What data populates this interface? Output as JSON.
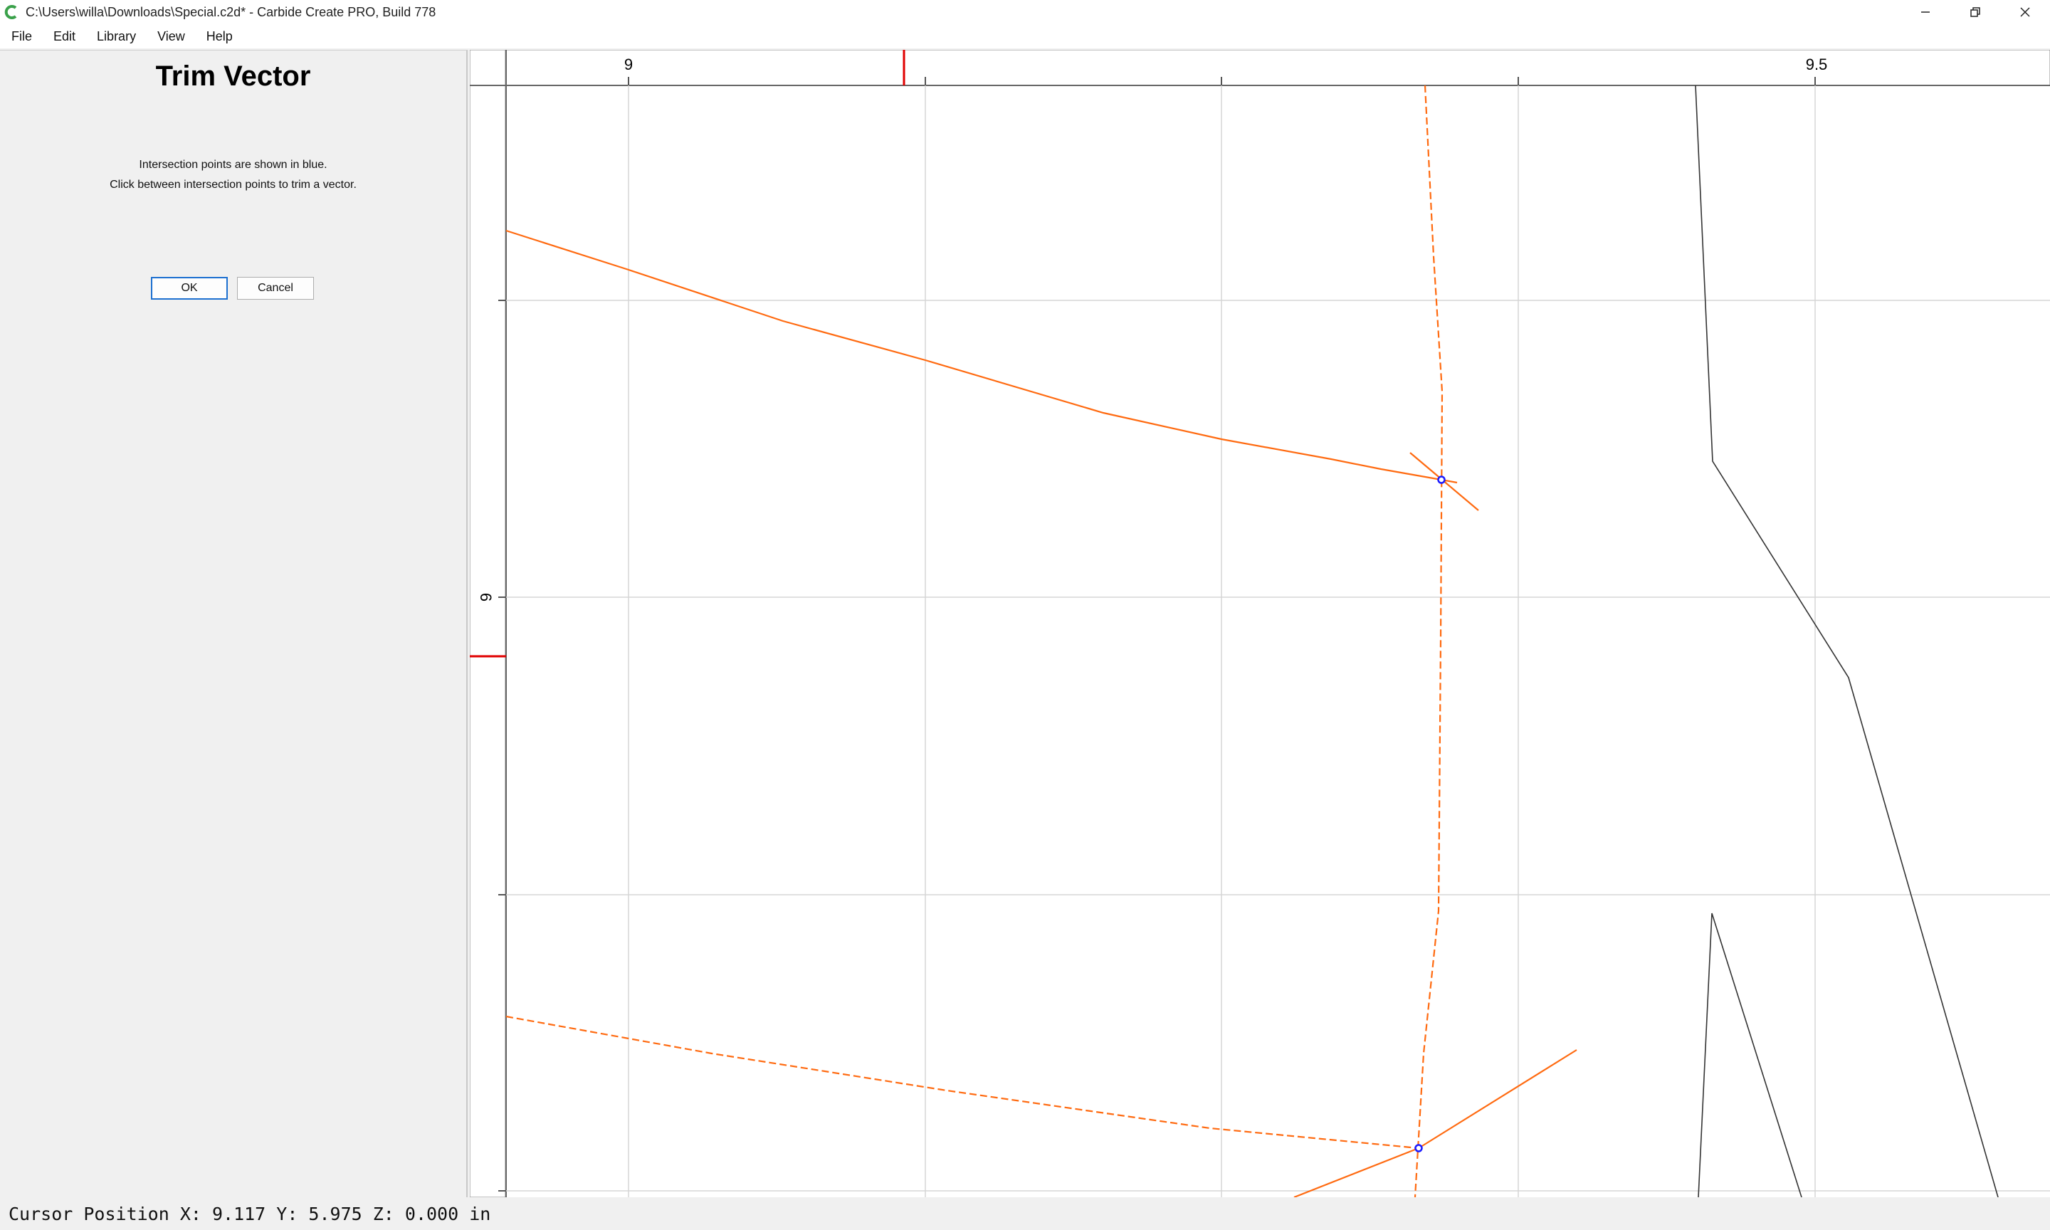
{
  "window": {
    "title": "C:\\Users\\willa\\Downloads\\Special.c2d* - Carbide Create PRO, Build 778",
    "controls": [
      "minimize-icon",
      "restore-icon",
      "close-icon"
    ]
  },
  "menu": {
    "file": "File",
    "edit": "Edit",
    "library": "Library",
    "view": "View",
    "help": "Help"
  },
  "panel": {
    "title": "Trim Vector",
    "line1": "Intersection points are shown in blue.",
    "line2": "Click between intersection points to trim a vector.",
    "ok_label": "OK",
    "cancel_label": "Cancel"
  },
  "ruler": {
    "x_labels": [
      "9",
      "9.5"
    ],
    "y_labels": [
      "6"
    ]
  },
  "status": {
    "text": "Cursor Position X: 9.117 Y: 5.975 Z: 0.000 in"
  },
  "colors": {
    "vector": "#ff6a10",
    "intersection": "#1a1aff",
    "cursor_marker": "#e00000",
    "other_vector": "#333333"
  }
}
